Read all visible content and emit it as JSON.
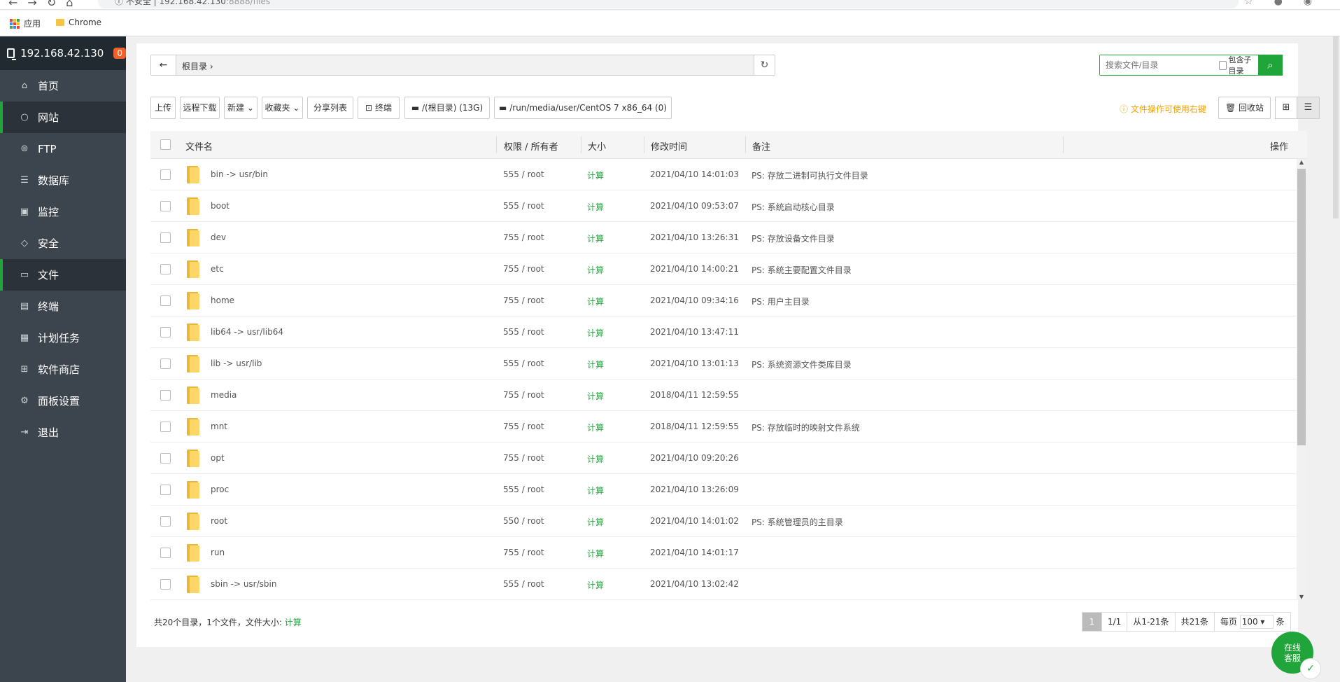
{
  "browser": {
    "url_host": "192.168.42.130",
    "url_rest": ":8888/files",
    "security_label": "不安全",
    "bookmarks": [
      {
        "label": "应用"
      },
      {
        "label": "Chrome"
      }
    ]
  },
  "sidebar": {
    "server": "192.168.42.130",
    "badge": "0",
    "items": [
      {
        "label": "首页",
        "icon": "home-icon"
      },
      {
        "label": "网站",
        "icon": "globe-icon"
      },
      {
        "label": "FTP",
        "icon": "ftp-icon"
      },
      {
        "label": "数据库",
        "icon": "database-icon"
      },
      {
        "label": "监控",
        "icon": "monitor-icon"
      },
      {
        "label": "安全",
        "icon": "shield-icon"
      },
      {
        "label": "文件",
        "icon": "folder-icon"
      },
      {
        "label": "终端",
        "icon": "terminal-icon"
      },
      {
        "label": "计划任务",
        "icon": "calendar-icon"
      },
      {
        "label": "软件商店",
        "icon": "apps-icon"
      },
      {
        "label": "面板设置",
        "icon": "gear-icon"
      },
      {
        "label": "退出",
        "icon": "logout-icon"
      }
    ]
  },
  "path": {
    "crumb": "根目录",
    "sep": "›"
  },
  "search": {
    "placeholder": "搜索文件/目录",
    "subdir_label": "包含子目录"
  },
  "toolbar": {
    "upload": "上传",
    "remote_download": "远程下载",
    "new": "新建",
    "favorites": "收藏夹",
    "share_list": "分享列表",
    "terminal": "终端",
    "disk1": "/(根目录) (13G)",
    "disk2": "/run/media/user/CentOS 7 x86_64 (0)",
    "hint": "文件操作可使用右键",
    "recycle": "回收站"
  },
  "table": {
    "headers": {
      "name": "文件名",
      "perm": "权限 / 所有者",
      "size": "大小",
      "mtime": "修改时间",
      "note": "备注",
      "ops": "操作"
    },
    "rows": [
      {
        "name": "bin -> usr/bin",
        "perm": "555 / root",
        "size": "计算",
        "mtime": "2021/04/10 14:01:03",
        "note": "PS: 存放二进制可执行文件目录"
      },
      {
        "name": "boot",
        "perm": "555 / root",
        "size": "计算",
        "mtime": "2021/04/10 09:53:07",
        "note": "PS: 系统启动核心目录"
      },
      {
        "name": "dev",
        "perm": "755 / root",
        "size": "计算",
        "mtime": "2021/04/10 13:26:31",
        "note": "PS: 存放设备文件目录"
      },
      {
        "name": "etc",
        "perm": "755 / root",
        "size": "计算",
        "mtime": "2021/04/10 14:00:21",
        "note": "PS: 系统主要配置文件目录"
      },
      {
        "name": "home",
        "perm": "755 / root",
        "size": "计算",
        "mtime": "2021/04/10 09:34:16",
        "note": "PS: 用户主目录"
      },
      {
        "name": "lib64 -> usr/lib64",
        "perm": "555 / root",
        "size": "计算",
        "mtime": "2021/04/10 13:47:11",
        "note": ""
      },
      {
        "name": "lib -> usr/lib",
        "perm": "555 / root",
        "size": "计算",
        "mtime": "2021/04/10 13:01:13",
        "note": "PS: 系统资源文件类库目录"
      },
      {
        "name": "media",
        "perm": "755 / root",
        "size": "计算",
        "mtime": "2018/04/11 12:59:55",
        "note": ""
      },
      {
        "name": "mnt",
        "perm": "755 / root",
        "size": "计算",
        "mtime": "2018/04/11 12:59:55",
        "note": "PS: 存放临时的映射文件系统"
      },
      {
        "name": "opt",
        "perm": "755 / root",
        "size": "计算",
        "mtime": "2021/04/10 09:20:26",
        "note": ""
      },
      {
        "name": "proc",
        "perm": "555 / root",
        "size": "计算",
        "mtime": "2021/04/10 13:26:09",
        "note": ""
      },
      {
        "name": "root",
        "perm": "550 / root",
        "size": "计算",
        "mtime": "2021/04/10 14:01:02",
        "note": "PS: 系统管理员的主目录"
      },
      {
        "name": "run",
        "perm": "755 / root",
        "size": "计算",
        "mtime": "2021/04/10 14:01:17",
        "note": ""
      },
      {
        "name": "sbin -> usr/sbin",
        "perm": "555 / root",
        "size": "计算",
        "mtime": "2021/04/10 13:02:42",
        "note": ""
      }
    ]
  },
  "footer": {
    "summary": "共20个目录，1个文件，文件大小:",
    "calc": "计算",
    "page_current": "1",
    "page_total": "1/1",
    "range": "从1-21条",
    "total": "共21条",
    "per_page_label": "每页",
    "per_page_value": "100",
    "per_page_unit": "条"
  },
  "chat": {
    "label_line1": "在线",
    "label_line2": "客服"
  },
  "colors": {
    "accent": "#20a53a",
    "sidebar": "#3c444d",
    "badge": "#f0602a",
    "hint": "#f0a100"
  }
}
